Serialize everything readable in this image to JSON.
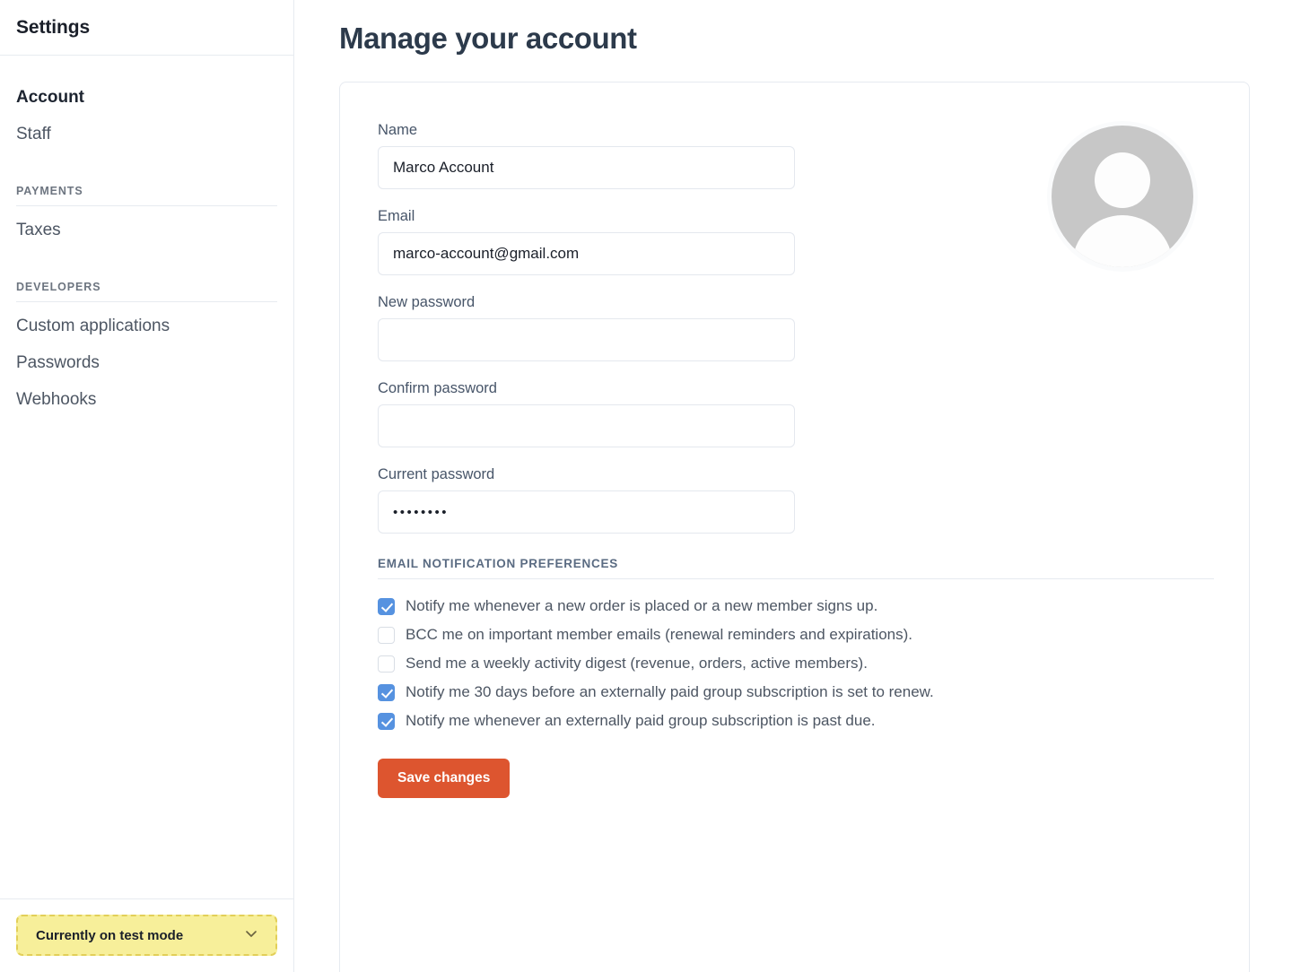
{
  "sidebar": {
    "title": "Settings",
    "top_items": [
      {
        "label": "Account",
        "active": true
      },
      {
        "label": "Staff",
        "active": false
      }
    ],
    "sections": [
      {
        "label": "PAYMENTS",
        "items": [
          {
            "label": "Taxes"
          }
        ]
      },
      {
        "label": "DEVELOPERS",
        "items": [
          {
            "label": "Custom applications"
          },
          {
            "label": "Passwords"
          },
          {
            "label": "Webhooks"
          }
        ]
      }
    ],
    "test_mode": {
      "label": "Currently on test mode",
      "icon": "chevron-down-icon",
      "background_color": "#f7ef9a",
      "border_color": "#e2cf58"
    }
  },
  "main": {
    "page_title": "Manage your account",
    "fields": [
      {
        "label": "Name",
        "value": "Marco Account",
        "placeholder": "",
        "type": "text"
      },
      {
        "label": "Email",
        "value": "marco-account@gmail.com",
        "placeholder": "",
        "type": "text"
      },
      {
        "label": "New password",
        "value": "",
        "placeholder": "",
        "type": "password"
      },
      {
        "label": "Confirm password",
        "value": "",
        "placeholder": "",
        "type": "password"
      },
      {
        "label": "Current password",
        "value": "••••••••",
        "placeholder": "",
        "type": "password"
      }
    ],
    "avatar": {
      "icon": "default-avatar-icon",
      "color": "#c7c7c7"
    },
    "preferences": {
      "header": "EMAIL NOTIFICATION PREFERENCES",
      "items": [
        {
          "label": "Notify me whenever a new order is placed or a new member signs up.",
          "checked": true
        },
        {
          "label": "BCC me on important member emails (renewal reminders and expirations).",
          "checked": false
        },
        {
          "label": "Send me a weekly activity digest (revenue, orders, active members).",
          "checked": false
        },
        {
          "label": "Notify me 30 days before an externally paid group subscription is set to renew.",
          "checked": true
        },
        {
          "label": "Notify me whenever an externally paid group subscription is past due.",
          "checked": true
        }
      ],
      "checked_color": "#5692e0"
    },
    "save_button": {
      "label": "Save changes",
      "color": "#dd552f"
    }
  }
}
